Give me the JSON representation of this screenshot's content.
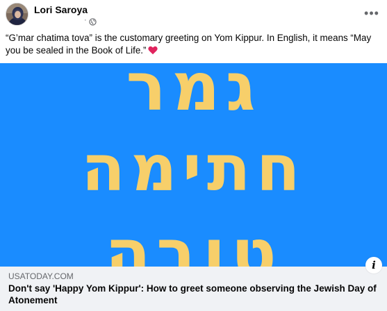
{
  "post": {
    "author": "Lori Saroya",
    "meta_separator": "·",
    "more_label": "•••",
    "caption": "“G’mar chatima tova” is the customary greeting on Yom Kippur. In English, it means “May you be sealed in the Book of Life.”",
    "caption_icon": "red-heart-icon",
    "privacy_icon": "globe-icon"
  },
  "preview": {
    "hebrew_lines": [
      "גמר",
      "חתימה",
      "טובה"
    ],
    "background_color": "#1a8cff",
    "text_color": "#f7cf6a",
    "info_label": "i"
  },
  "link": {
    "source": "USATODAY.COM",
    "title": "Don't say 'Happy Yom Kippur': How to greet someone observing the Jewish Day of Atonement"
  }
}
